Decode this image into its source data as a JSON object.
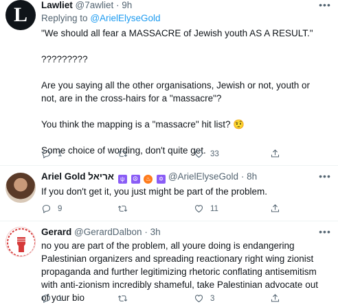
{
  "tweets": [
    {
      "display_name": "Lawliet",
      "handle": "@7awliet",
      "time": "9h",
      "replying_prefix": "Replying to",
      "replying_to": "@ArielElyseGold",
      "paragraphs": [
        "\"We should all fear a MASSACRE of Jewish youth AS A RESULT.\"",
        "?????????",
        "Are you saying all the other organisations, Jewish or not, youth or not, are in the cross-hairs for a \"massacre\"?",
        "You think the mapping is a \"massacre\" hit list? 🤨",
        "Some choice of wording, don't quite get."
      ],
      "reply_count": "1",
      "retweet_count": "",
      "like_count": "33",
      "avatar_letter": "L"
    },
    {
      "display_name": "Ariel Gold אריאל",
      "handle": "@ArielElyseGold",
      "time": "8h",
      "paragraphs": [
        "If you don't get it, you just might be part of the problem."
      ],
      "reply_count": "9",
      "retweet_count": "",
      "like_count": "11"
    },
    {
      "display_name": "Gerard",
      "handle": "@GerardDalbon",
      "time": "3h",
      "paragraphs": [
        "no you are part of the problem, all youre doing is endangering Palestinian organizers and spreading reactionary right wing zionist propaganda and further legitimizing rhetoric conflating antisemitism with anti-zionism incredibly shameful, take Palestinian advocate out of your bio"
      ],
      "reply_count": "1",
      "retweet_count": "",
      "like_count": "3"
    }
  ],
  "separator": "·",
  "colors": {
    "link": "#1d9bf0",
    "muted": "#536471",
    "divider": "#eff3f4"
  }
}
